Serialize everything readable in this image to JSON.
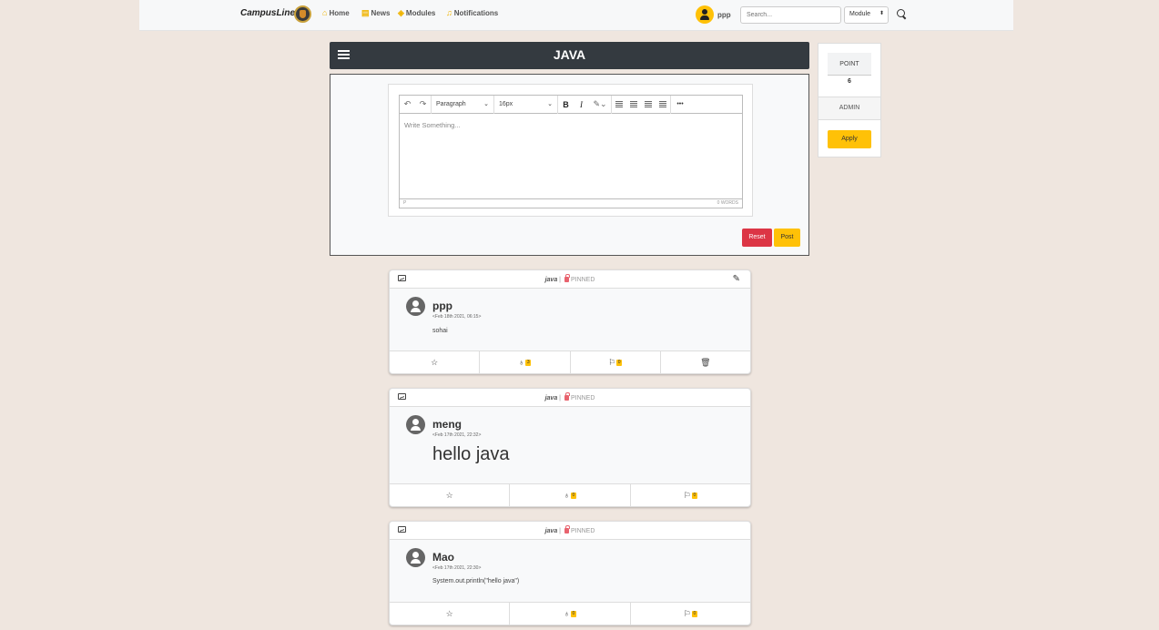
{
  "nav": {
    "brand": "CampusLine",
    "links": [
      {
        "label": "Home",
        "icon": "home-icon"
      },
      {
        "label": "News",
        "icon": "news-icon"
      },
      {
        "label": "Modules",
        "icon": "box-icon"
      },
      {
        "label": "Notifications",
        "icon": "bell-icon"
      }
    ],
    "user": "ppp",
    "search_placeholder": "Search...",
    "select_value": "Module"
  },
  "section": {
    "title": "JAVA"
  },
  "editor": {
    "block_format": "Paragraph",
    "font_size": "16px",
    "placeholder": "Write Something...",
    "status_path": "P",
    "word_count": "0 WORDS",
    "more_label": "•••",
    "reset_label": "Reset",
    "post_label": "Post"
  },
  "side": {
    "point_label": "POINT",
    "point_value": "6",
    "role": "ADMIN",
    "apply_label": "Apply"
  },
  "posts": [
    {
      "module": "java",
      "sep": "|",
      "pinned": "PINNED",
      "author": "ppp",
      "date": "<Feb 18th 2021, 06:15>",
      "content": "sohai",
      "likes": "3",
      "comments": "0"
    },
    {
      "module": "java",
      "sep": "|",
      "pinned": "PINNED",
      "author": "meng",
      "date": "<Feb 17th 2021, 22:32>",
      "content": "hello java",
      "likes": "0",
      "comments": "0"
    },
    {
      "module": "java",
      "sep": "|",
      "pinned": "PINNED",
      "author": "Mao",
      "date": "<Feb 17th 2021, 22:30>",
      "content": "System.out.println(\"hello java\")",
      "likes": "0",
      "comments": "0"
    }
  ],
  "colors": {
    "accent": "#ffc107",
    "danger": "#dc3545",
    "header": "#343a40",
    "background": "#efe6df"
  }
}
